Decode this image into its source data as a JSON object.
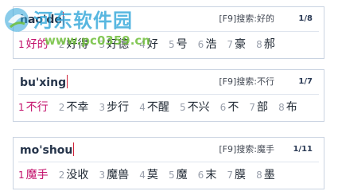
{
  "panels": [
    {
      "pinyin": "hao'de",
      "search_hint": "[F9]搜索:好的",
      "page": "1/8",
      "candidates": [
        {
          "num": "1",
          "text": "好的"
        },
        {
          "num": "2",
          "text": "好得"
        },
        {
          "num": "3",
          "text": "好德"
        },
        {
          "num": "4",
          "text": "好"
        },
        {
          "num": "5",
          "text": "号"
        },
        {
          "num": "6",
          "text": "浩"
        },
        {
          "num": "7",
          "text": "豪"
        },
        {
          "num": "8",
          "text": "郝"
        }
      ]
    },
    {
      "pinyin": "bu'xing",
      "search_hint": "[F9]搜索:不行",
      "page": "1/7",
      "candidates": [
        {
          "num": "1",
          "text": "不行"
        },
        {
          "num": "2",
          "text": "不幸"
        },
        {
          "num": "3",
          "text": "步行"
        },
        {
          "num": "4",
          "text": "不醒"
        },
        {
          "num": "5",
          "text": "不兴"
        },
        {
          "num": "6",
          "text": "不"
        },
        {
          "num": "7",
          "text": "部"
        },
        {
          "num": "8",
          "text": "布"
        }
      ]
    },
    {
      "pinyin": "mo'shou",
      "search_hint": "[F9]搜索:魔手",
      "page": "1/11",
      "candidates": [
        {
          "num": "1",
          "text": "魔手"
        },
        {
          "num": "2",
          "text": "没收"
        },
        {
          "num": "3",
          "text": "魔兽"
        },
        {
          "num": "4",
          "text": "莫"
        },
        {
          "num": "5",
          "text": "魔"
        },
        {
          "num": "6",
          "text": "末"
        },
        {
          "num": "7",
          "text": "膜"
        },
        {
          "num": "8",
          "text": "墨"
        }
      ]
    }
  ],
  "watermark": {
    "title": "河东软件园",
    "url": "www.pc0359.cn"
  },
  "colors": {
    "selected": "#c3106b",
    "border": "#c9d3e1",
    "caret": "#d0243a"
  }
}
